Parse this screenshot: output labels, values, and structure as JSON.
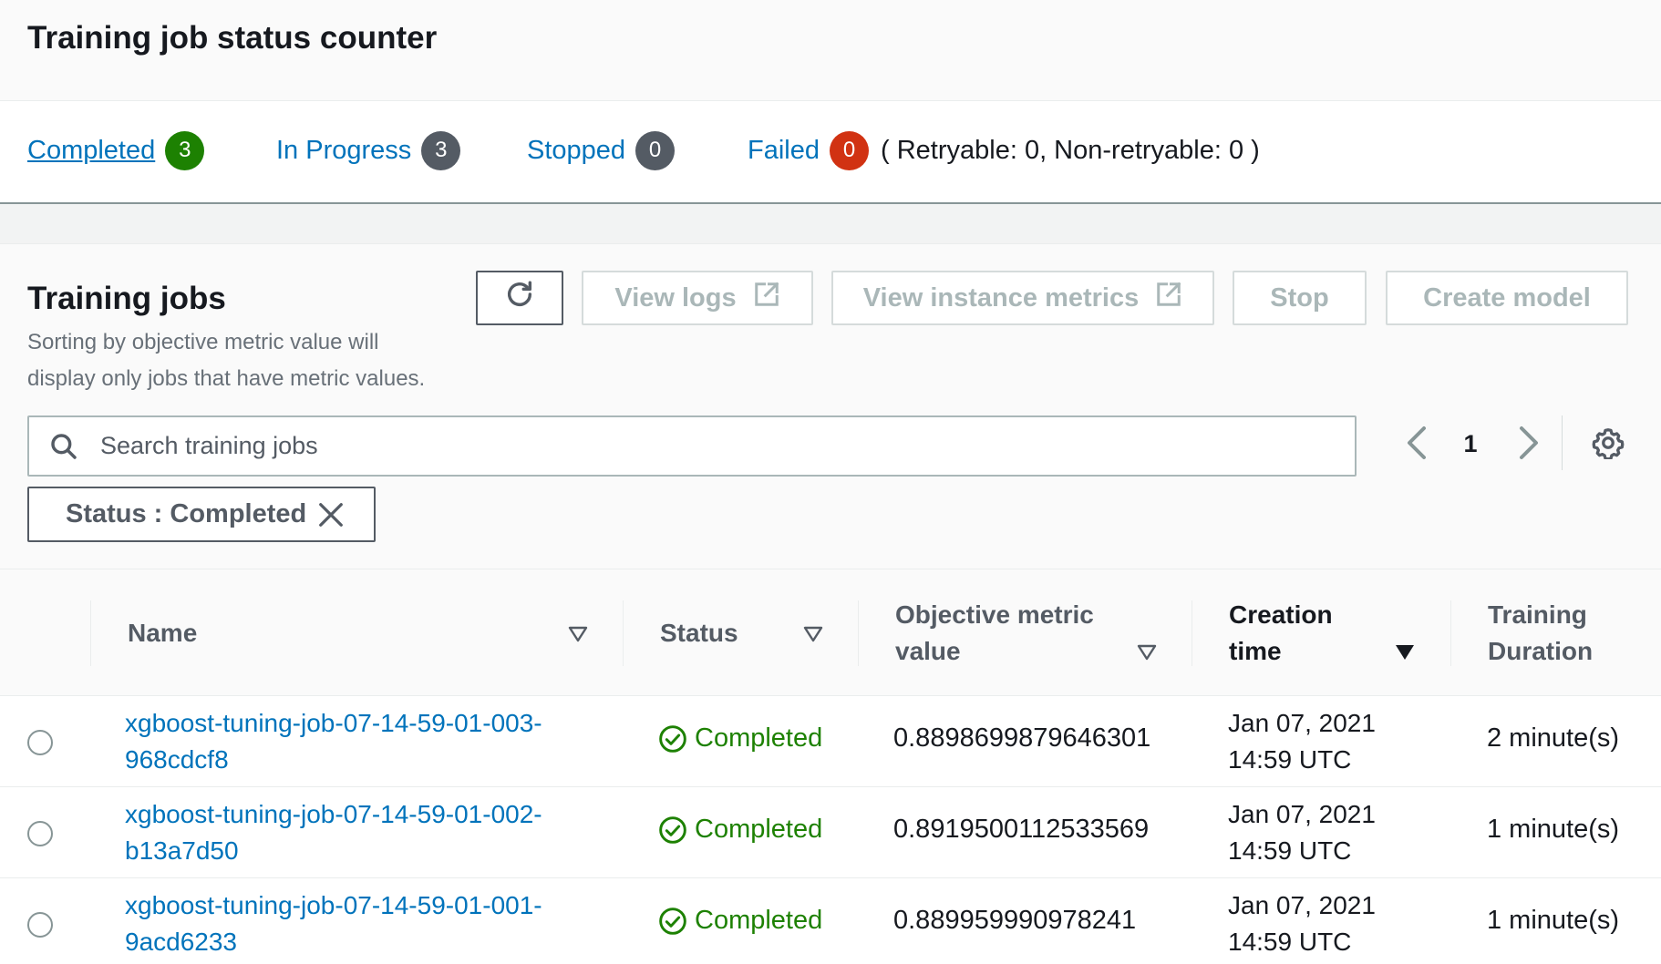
{
  "counter": {
    "title": "Training job status counter",
    "completed_label": "Completed",
    "completed_count": "3",
    "in_progress_label": "In Progress",
    "in_progress_count": "3",
    "stopped_label": "Stopped",
    "stopped_count": "0",
    "failed_label": "Failed",
    "failed_count": "0",
    "retry_note": "( Retryable: 0, Non-retryable: 0 )"
  },
  "jobs": {
    "title": "Training jobs",
    "description": "Sorting by objective metric value will display only jobs that have metric values.",
    "toolbar": {
      "view_logs": "View logs",
      "view_instance_metrics": "View instance metrics",
      "stop": "Stop",
      "create_model": "Create model"
    },
    "search": {
      "placeholder": "Search training jobs",
      "value": ""
    },
    "pagination": {
      "current_page": "1"
    },
    "filter_token": "Status : Completed",
    "columns": {
      "name": "Name",
      "status": "Status",
      "objective_line1": "Objective metric",
      "objective_line2": "value",
      "creation_line1": "Creation",
      "creation_line2": "time",
      "duration_line1": "Training",
      "duration_line2": "Duration"
    },
    "rows": [
      {
        "name_line1": "xgboost-tuning-job-07-14-59-01-003-",
        "name_line2": "968cdcf8",
        "status": "Completed",
        "objective_metric": "0.8898699879646301",
        "creation_date": "Jan 07, 2021",
        "creation_time": "14:59 UTC",
        "duration": "2 minute(s)"
      },
      {
        "name_line1": "xgboost-tuning-job-07-14-59-01-002-",
        "name_line2": "b13a7d50",
        "status": "Completed",
        "objective_metric": "0.8919500112533569",
        "creation_date": "Jan 07, 2021",
        "creation_time": "14:59 UTC",
        "duration": "1 minute(s)"
      },
      {
        "name_line1": "xgboost-tuning-job-07-14-59-01-001-",
        "name_line2": "9acd6233",
        "status": "Completed",
        "objective_metric": "0.889959990978241",
        "creation_date": "Jan 07, 2021",
        "creation_time": "14:59 UTC",
        "duration": "1 minute(s)"
      }
    ]
  },
  "icons": {
    "refresh": "refresh-icon",
    "external": "external-link-icon",
    "search": "search-icon",
    "prev": "chevron-left-icon",
    "next": "chevron-right-icon",
    "settings": "gear-icon",
    "close": "close-icon",
    "sort": "sort-triangle-icon",
    "status_ok": "check-circle-icon"
  },
  "colors": {
    "link": "#0073bb",
    "success": "#1d8102",
    "badge_dark": "#545b64",
    "badge_error": "#d13212"
  }
}
